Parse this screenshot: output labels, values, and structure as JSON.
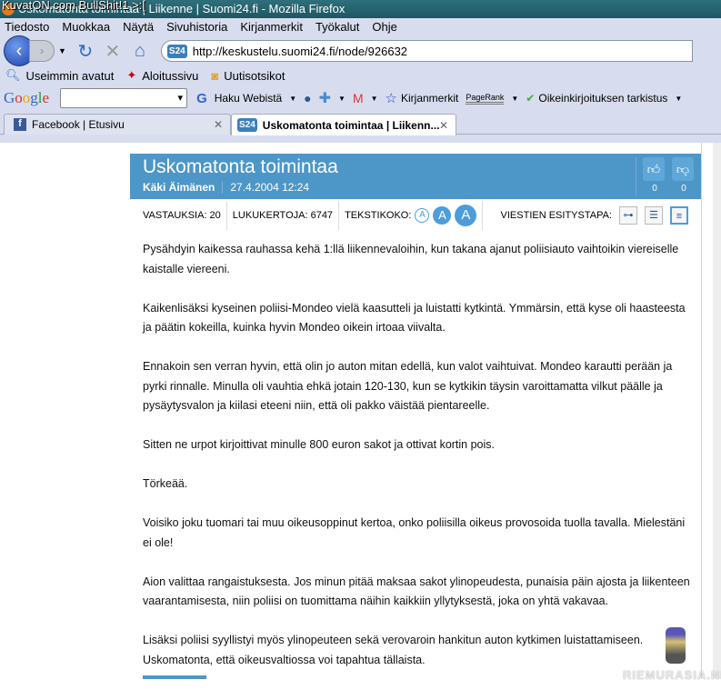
{
  "window": {
    "title": "Uskomatonta toimintaa | Liikenne | Suomi24.fi - Mozilla Firefox",
    "watermark": "KuvatON.com BullShit!1 >:["
  },
  "menu": [
    "Tiedosto",
    "Muokkaa",
    "Näytä",
    "Sivuhistoria",
    "Kirjanmerkit",
    "Työkalut",
    "Ohje"
  ],
  "url": "http://keskustelu.suomi24.fi/node/926632",
  "bookmarks": [
    "Useimmin avatut",
    "Aloitussivu",
    "Uutisotsikot"
  ],
  "googlebar": {
    "logo": "Google",
    "search": "Haku Webistä",
    "bookmarks": "Kirjanmerkit",
    "pagerank": "PageRank",
    "spell": "Oikeinkirjoituksen tarkistus"
  },
  "tabs": [
    {
      "label": "Facebook | Etusivu"
    },
    {
      "label": "Uskomatonta toimintaa | Liikenn..."
    }
  ],
  "post": {
    "title": "Uskomatonta toimintaa",
    "author": "Käki Äimänen",
    "date": "27.4.2004 12:24",
    "likes": "0",
    "dislikes": "0",
    "replies": "VASTAUKSIA: 20",
    "views": "LUKUKERTOJA: 6747",
    "textsize": "TEKSTIKOKO:",
    "font_a": "A",
    "viewmode": "VIESTIEN ESITYSTAPA:",
    "paragraphs": [
      "Pysähdyin kaikessa rauhassa kehä 1:llä liikennevaloihin, kun takana ajanut poliisiauto vaihtoikin viereiselle kaistalle viereeni.",
      "Kaikenlisäksi kyseinen poliisi-Mondeo vielä kaasutteli ja luistatti kytkintä. Ymmärsin, että kyse oli haasteesta ja päätin kokeilla, kuinka hyvin Mondeo oikein irtoaa viivalta.",
      "Ennakoin sen verran hyvin, että olin jo auton mitan edellä, kun valot vaihtuivat. Mondeo karautti perään ja pyrki rinnalle. Minulla oli vauhtia ehkä jotain 120-130, kun se kytkikin täysin varoittamatta vilkut päälle ja pysäytysvalon ja kiilasi eteeni niin, että oli pakko väistää pientareelle.",
      "Sitten ne urpot kirjoittivat minulle 800 euron sakot ja ottivat kortin pois.",
      "Törkeää.",
      "Voisiko joku tuomari tai muu oikeusoppinut kertoa, onko poliisilla oikeus provosoida tuolla tavalla. Mielestäni ei ole!",
      "Aion valittaa rangaistuksesta. Jos minun pitää maksaa sakot ylinopeudesta, punaisia päin ajosta ja liikenteen vaarantamisesta, niin poliisi on tuomittama näihin kaikkiin yllytyksestä, joka on yhtä vakavaa.",
      "Lisäksi poliisi syyllistyi myös ylinopeuteen sekä verovaroin hankitun auton kytkimen luistattamiseen. Uskomatonta, että oikeusvaltiossa voi tapahtua tällaista."
    ]
  },
  "site_watermark": "RIEMURASIA.NET"
}
